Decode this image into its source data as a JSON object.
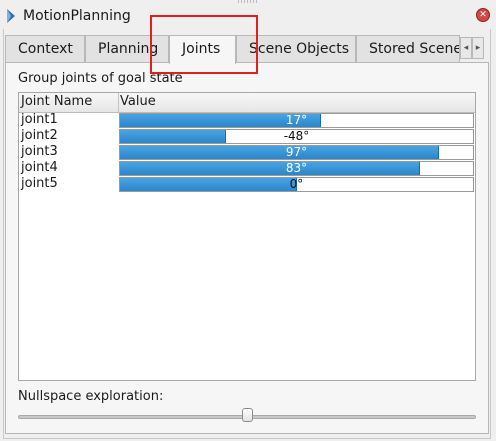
{
  "window": {
    "title": "MotionPlanning",
    "icon": "rviz-panel-icon",
    "close_icon": "close-icon"
  },
  "tabs": [
    {
      "label": "Context",
      "active": false
    },
    {
      "label": "Planning",
      "active": false
    },
    {
      "label": "Joints",
      "active": true
    },
    {
      "label": "Scene Objects",
      "active": false
    },
    {
      "label": "Stored Scenes",
      "active": false
    }
  ],
  "tab_scroll": {
    "left": "◂",
    "right": "▸"
  },
  "joints_panel": {
    "group_label": "Group joints of goal state",
    "columns": [
      "Joint Name",
      "Value"
    ],
    "rows": [
      {
        "name": "joint1",
        "value": "17°",
        "fill": 0.57
      },
      {
        "name": "joint2",
        "value": "-48°",
        "fill": 0.3
      },
      {
        "name": "joint3",
        "value": "97°",
        "fill": 0.905
      },
      {
        "name": "joint4",
        "value": "83°",
        "fill": 0.85
      },
      {
        "name": "joint5",
        "value": "0°",
        "fill": 0.5
      }
    ]
  },
  "nullspace": {
    "label": "Nullspace exploration:",
    "level": 0.5
  },
  "accent_color": "#2a86cc",
  "highlight_color": "#e02020"
}
